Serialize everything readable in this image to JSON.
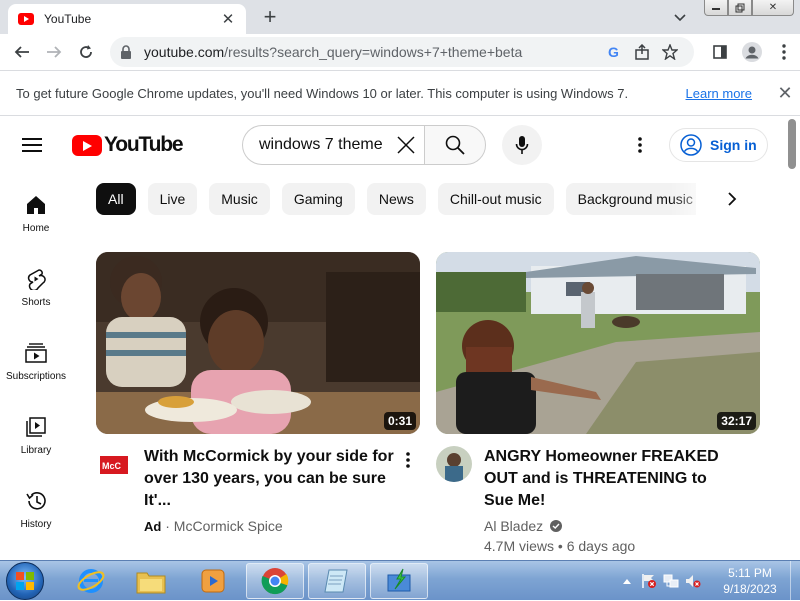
{
  "browser": {
    "tab_title": "YouTube",
    "url_main": "youtube.com",
    "url_rest": "/results?search_query=windows+7+theme+beta"
  },
  "infobar": {
    "message": "To get future Google Chrome updates, you'll need Windows 10 or later. This computer is using Windows 7.",
    "link": "Learn more"
  },
  "youtube": {
    "logo_text": "YouTube",
    "search_query": "windows 7 theme beta",
    "sign_in": "Sign in",
    "chips": [
      "All",
      "Live",
      "Music",
      "Gaming",
      "News",
      "Chill-out music",
      "Background music"
    ],
    "guide": [
      {
        "label": "Home",
        "icon": "home-icon"
      },
      {
        "label": "Shorts",
        "icon": "shorts-icon"
      },
      {
        "label": "Subscriptions",
        "icon": "subscriptions-icon"
      },
      {
        "label": "Library",
        "icon": "library-icon"
      },
      {
        "label": "History",
        "icon": "history-icon"
      }
    ],
    "videos": [
      {
        "title": "With McCormick by your side for over 130 years, you can be sure It'...",
        "ad_label": "Ad",
        "channel": "McCormick Spice",
        "duration": "0:31"
      },
      {
        "title": "ANGRY Homeowner FREAKED OUT and is THREATENING to Sue Me!",
        "channel": "Al Bladez",
        "stats": "4.7M views • 6 days ago",
        "duration": "32:17"
      }
    ]
  },
  "taskbar": {
    "time": "5:11 PM",
    "date": "9/18/2023"
  },
  "colors": {
    "youtube_red": "#ff0000",
    "chrome_link": "#1a73e8",
    "signin_blue": "#065fd4"
  }
}
